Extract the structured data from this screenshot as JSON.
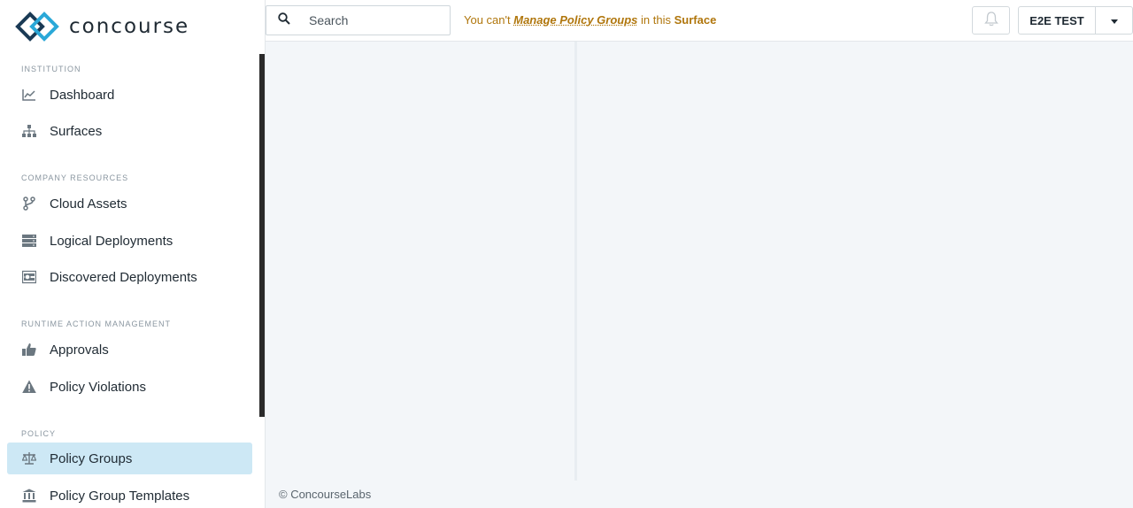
{
  "brand": {
    "name": "concourse"
  },
  "sidebar": {
    "sections": [
      {
        "label": "INSTITUTION",
        "items": [
          {
            "label": "Dashboard",
            "icon": "line-chart-icon"
          },
          {
            "label": "Surfaces",
            "icon": "sitemap-icon"
          }
        ]
      },
      {
        "label": "COMPANY RESOURCES",
        "items": [
          {
            "label": "Cloud Assets",
            "icon": "branch-icon"
          },
          {
            "label": "Logical Deployments",
            "icon": "server-icon"
          },
          {
            "label": "Discovered Deployments",
            "icon": "discovered-icon"
          }
        ]
      },
      {
        "label": "RUNTIME ACTION MANAGEMENT",
        "items": [
          {
            "label": "Approvals",
            "icon": "thumbs-up-icon"
          },
          {
            "label": "Policy Violations",
            "icon": "warning-icon"
          }
        ]
      },
      {
        "label": "POLICY",
        "items": [
          {
            "label": "Policy Groups",
            "icon": "balance-scale-icon",
            "active": true
          },
          {
            "label": "Policy Group Templates",
            "icon": "bank-icon"
          }
        ]
      }
    ]
  },
  "topbar": {
    "search": {
      "placeholder": "Search"
    },
    "warning": {
      "prefix": "You can't",
      "action": "Manage Policy Groups",
      "middle": "in this",
      "target": "Surface"
    },
    "org": {
      "label": "E2E TEST"
    }
  },
  "footer": {
    "text": "© ConcourseLabs"
  },
  "colors": {
    "accent": "#cde8f5",
    "warning": "#b0760c",
    "brand_blue": "#2aa8d8"
  }
}
